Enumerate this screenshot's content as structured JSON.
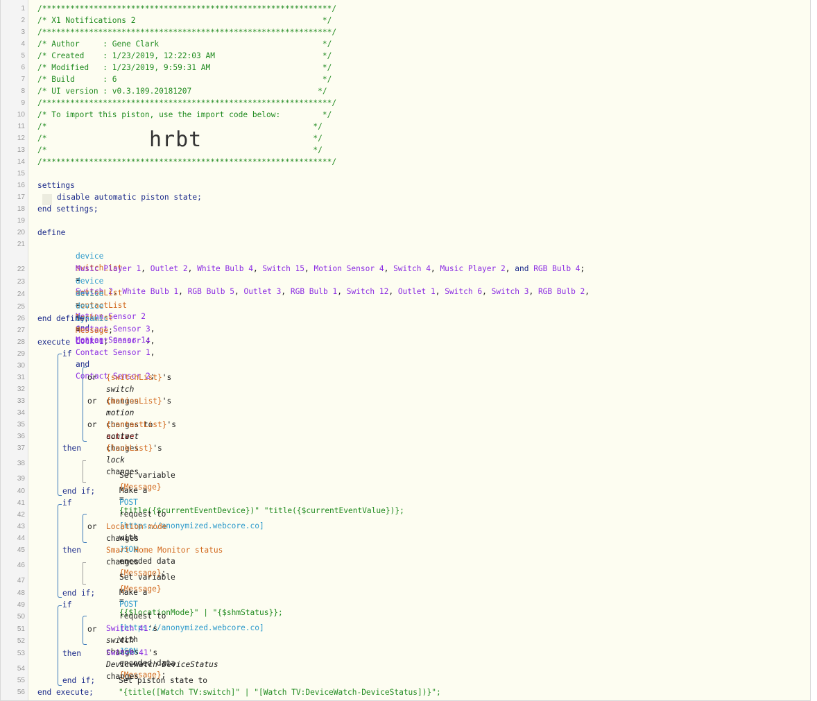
{
  "header_comment": {
    "border": "/**************************************************************/",
    "title": "/* X1 Notifications 2                                        */",
    "author": "/* Author     : Gene Clark                                   */",
    "created": "/* Created    : 1/23/2019, 12:22:03 AM                       */",
    "modified": "/* Modified   : 1/23/2019, 9:59:31 AM                        */",
    "build": "/* Build      : 6                                            */",
    "ui_version": "/* UI version : v0.3.109.20181207                           */",
    "import_note": "/* To import this piston, use the import code below:         */",
    "blank": "/*                                                         */",
    "import_code": "hrbt"
  },
  "settings": {
    "open": "settings",
    "item": "disable automatic piston state;",
    "close": "end settings;"
  },
  "define": {
    "open": "define",
    "device_kw": "device",
    "switchList_name": "switchList",
    "switchList_devices_1": [
      "Switch 2",
      "White Bulb 1",
      "RGB Bulb 5",
      "Outlet 3",
      "RGB Bulb 1",
      "Switch 12",
      "Outlet 1",
      "Switch 6",
      "Switch 3",
      "RGB Bulb 2"
    ],
    "switchList_devices_2": [
      "Music Player 1",
      "Outlet 2",
      "White Bulb 4",
      "Switch 15",
      "Motion Sensor 4",
      "Switch 4",
      "Music Player 2"
    ],
    "switchList_last": "RGB Bulb 4",
    "motionList_name": "motionList",
    "motionList_devices": [
      "Motion Sensor 2",
      "Motion Sensor 1"
    ],
    "contactList_name": "contactList",
    "contactList_devices": [
      "Contact Sensor 3",
      "Contact Sensor 4",
      "Contact Sensor 1",
      "Contact Sensor 2"
    ],
    "lockList_name": "lockList",
    "lockList_devices": [
      "Lock 1"
    ],
    "dynamic_kw": "dynamic",
    "message_var": "Message",
    "close": "end define;"
  },
  "execute": {
    "open": "execute",
    "close": "end execute;",
    "if_kw": "if",
    "then_kw": "then",
    "or_kw": "or",
    "end_if": "end if;",
    "block1": {
      "c1_var": "{switchList}",
      "c1_attr": "switch",
      "c2_var": "{motionList}",
      "c2_attr": "motion",
      "c2_value": "active",
      "c3_var": "{contactList}",
      "c3_attr": "contact",
      "c4_var": "{lockList}",
      "c4_attr": "lock",
      "set_expr": "{title({$currentEventDevice})\" \"title({$currentEventValue})};",
      "url": "[https://anonymized.webcore.co]"
    },
    "block2": {
      "c1": "Location mode",
      "c2": "Smart Home Monitor status",
      "set_expr": "{{$locationMode}\" | \"{$shmStatus}};",
      "url": "[https://anonymized.webcore.co]"
    },
    "block3": {
      "device": "Switch 41",
      "c1_attr": "switch",
      "c2_attr": "DeviceWatch-DeviceStatus",
      "state_expr": "\"{title([Watch TV:switch]\" | \"[Watch TV:DeviceWatch-DeviceStatus])}\";"
    }
  },
  "statement_text": {
    "set_variable": "Set variable",
    "make_a": "Make a",
    "post": "POST",
    "request_to": "request to",
    "with": "with",
    "json": "JSON",
    "encoded_data": "encoded data",
    "message_ref": "{Message}",
    "set_piston_state": "Set piston state to",
    "changes": "changes",
    "changes_to": "changes to",
    "s_suffix": "'s",
    "and_kw": "and",
    "eq": "="
  },
  "line_numbers": [
    "1",
    "2",
    "3",
    "4",
    "5",
    "6",
    "7",
    "8",
    "9",
    "10",
    "11",
    "12",
    "13",
    "14",
    "15",
    "16",
    "17",
    "18",
    "19",
    "20",
    "21",
    "22",
    "23",
    "24",
    "25",
    "26",
    "27",
    "28",
    "29",
    "30",
    "31",
    "32",
    "33",
    "34",
    "35",
    "36",
    "37",
    "38",
    "39",
    "40",
    "41",
    "42",
    "43",
    "44",
    "45",
    "46",
    "47",
    "48",
    "49",
    "50",
    "51",
    "52",
    "53",
    "54",
    "55",
    "56"
  ]
}
